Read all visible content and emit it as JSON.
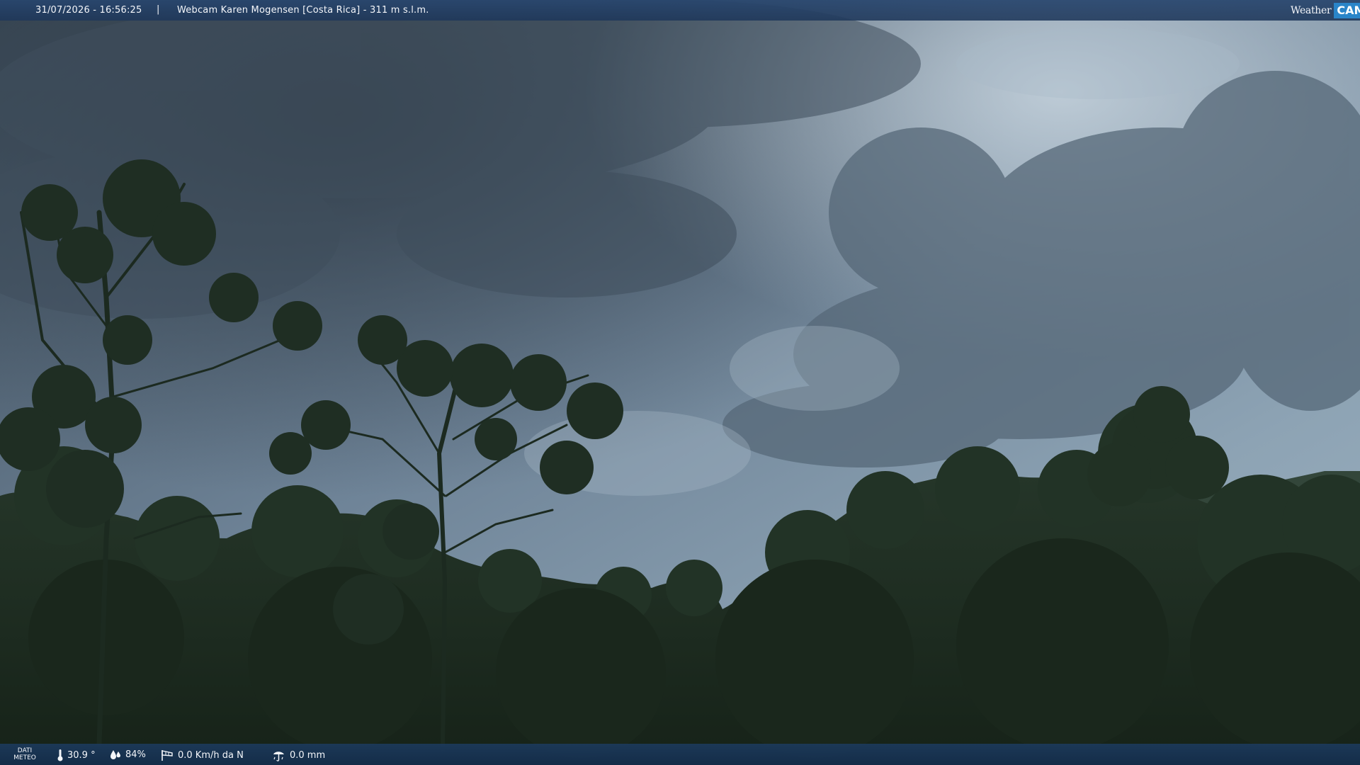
{
  "header": {
    "datetime": "31/07/2026 - 16:56:25",
    "separator": "|",
    "title": "Webcam Karen Mogensen [Costa Rica]  - 311 m s.l.m."
  },
  "logo": {
    "part1": "Weather",
    "part2": "CAM"
  },
  "footer": {
    "label_line1": "DATI",
    "label_line2": "METEO",
    "temperature": "30.9 °",
    "humidity": "84%",
    "wind": "0.0 Km/h da N",
    "rain": "0.0 mm"
  },
  "icons": {
    "temperature": "thermometer-icon",
    "humidity": "drops-icon",
    "wind": "windsock-icon",
    "rain": "rain-gauge-icon"
  },
  "colors": {
    "bar": "#284670",
    "logo_accent": "#2a85c9",
    "sky": "#7d93a6",
    "vegetation": "#1f2e22"
  }
}
